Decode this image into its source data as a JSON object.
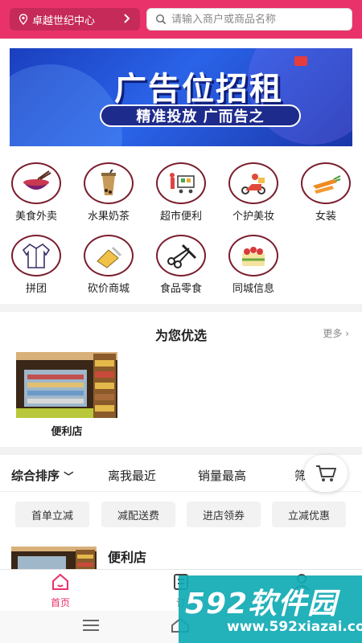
{
  "header": {
    "location": "卓越世纪中心",
    "search_placeholder": "请输入商户或商品名称"
  },
  "banner": {
    "title": "广告位招租",
    "subtitle": "精准投放 广而告之"
  },
  "categories": [
    {
      "label": "美食外卖",
      "icon": "food-bowl-icon"
    },
    {
      "label": "水果奶茶",
      "icon": "milk-tea-icon"
    },
    {
      "label": "超市便利",
      "icon": "supermarket-icon"
    },
    {
      "label": "个护美妆",
      "icon": "delivery-scooter-icon"
    },
    {
      "label": "女装",
      "icon": "carrots-icon"
    },
    {
      "label": "拼团",
      "icon": "jacket-icon"
    },
    {
      "label": "砍价商城",
      "icon": "cheese-knife-icon"
    },
    {
      "label": "食品零食",
      "icon": "scissors-comb-icon"
    },
    {
      "label": "同城信息",
      "icon": "cake-icon"
    }
  ],
  "recommend": {
    "title": "为您优选",
    "more": "更多",
    "shops": [
      {
        "name": "便利店"
      }
    ]
  },
  "sort": {
    "items": [
      "综合排序",
      "离我最近",
      "销量最高",
      "筛"
    ]
  },
  "chips": [
    "首单立减",
    "减配送费",
    "进店领券",
    "立减优惠"
  ],
  "list": [
    {
      "name": "便利店"
    }
  ],
  "tabbar": {
    "items": [
      {
        "label": "首页",
        "icon": "home-icon",
        "active": true
      },
      {
        "label": "订",
        "icon": "order-icon",
        "active": false
      },
      {
        "label": "",
        "icon": "user-icon",
        "active": false
      }
    ]
  },
  "watermark": {
    "logo": "592软件园",
    "url": "www.592xiazai.com"
  },
  "colors": {
    "brand": "#e9326a",
    "banner": "#2a63e8",
    "watermark": "#10aab4"
  }
}
